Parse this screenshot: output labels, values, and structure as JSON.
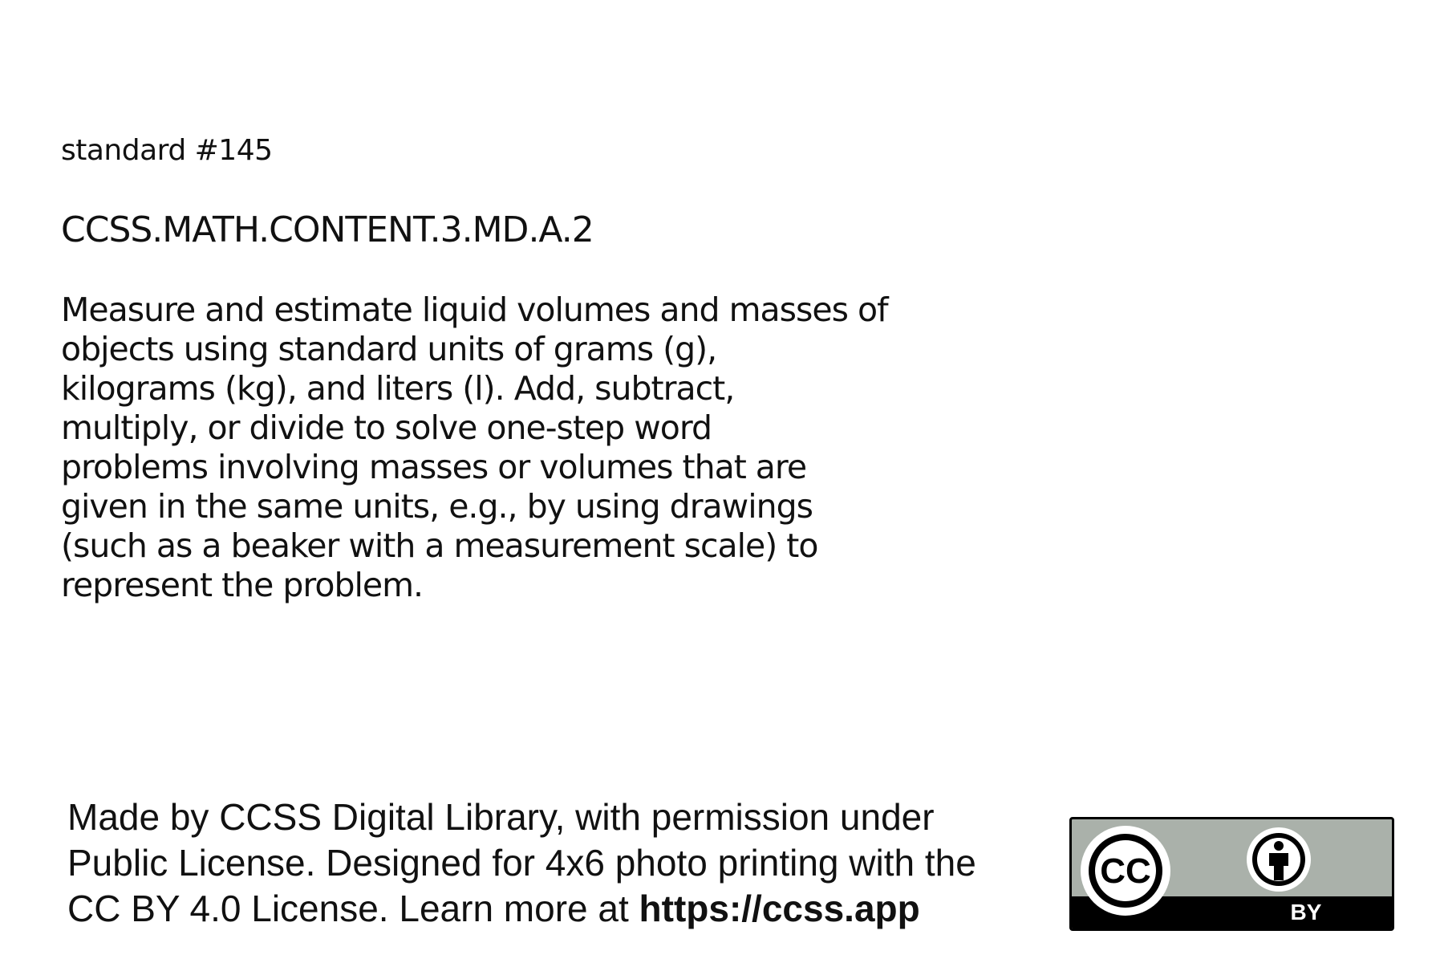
{
  "card": {
    "standard_number": "standard #145",
    "standard_code": "CCSS.MATH.CONTENT.3.MD.A.2",
    "standard_text_lines": [
      "Measure and estimate liquid volumes and masses of",
      "objects using standard units of grams (g),",
      "kilograms (kg), and liters (l). Add, subtract,",
      "multiply, or divide to solve one-step word",
      "problems involving masses or volumes that are",
      "given in the same units, e.g., by using drawings",
      "(such as a beaker with a measurement scale) to",
      "represent the problem."
    ]
  },
  "footer": {
    "line1": "Made by CCSS Digital Library, with permission under",
    "line2": "Public License. Designed for 4x6 photo printing with the",
    "line3_prefix": "CC BY 4.0 License. Learn more at ",
    "line3_link": "https://ccss.app"
  },
  "license_badge": {
    "cc_text": "CC",
    "by_text": "BY",
    "colors": {
      "badge_background": "#aab1aa",
      "badge_bar": "#000000",
      "icon_fill": "#ffffff"
    },
    "icons": [
      "cc-circle-icon",
      "attribution-person-icon"
    ]
  }
}
